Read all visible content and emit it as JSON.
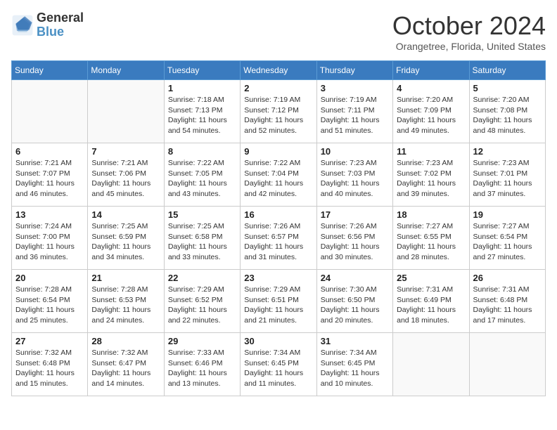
{
  "header": {
    "logo_line1": "General",
    "logo_line2": "Blue",
    "month": "October 2024",
    "location": "Orangetree, Florida, United States"
  },
  "weekdays": [
    "Sunday",
    "Monday",
    "Tuesday",
    "Wednesday",
    "Thursday",
    "Friday",
    "Saturday"
  ],
  "weeks": [
    [
      {
        "day": "",
        "info": ""
      },
      {
        "day": "",
        "info": ""
      },
      {
        "day": "1",
        "info": "Sunrise: 7:18 AM\nSunset: 7:13 PM\nDaylight: 11 hours and 54 minutes."
      },
      {
        "day": "2",
        "info": "Sunrise: 7:19 AM\nSunset: 7:12 PM\nDaylight: 11 hours and 52 minutes."
      },
      {
        "day": "3",
        "info": "Sunrise: 7:19 AM\nSunset: 7:11 PM\nDaylight: 11 hours and 51 minutes."
      },
      {
        "day": "4",
        "info": "Sunrise: 7:20 AM\nSunset: 7:09 PM\nDaylight: 11 hours and 49 minutes."
      },
      {
        "day": "5",
        "info": "Sunrise: 7:20 AM\nSunset: 7:08 PM\nDaylight: 11 hours and 48 minutes."
      }
    ],
    [
      {
        "day": "6",
        "info": "Sunrise: 7:21 AM\nSunset: 7:07 PM\nDaylight: 11 hours and 46 minutes."
      },
      {
        "day": "7",
        "info": "Sunrise: 7:21 AM\nSunset: 7:06 PM\nDaylight: 11 hours and 45 minutes."
      },
      {
        "day": "8",
        "info": "Sunrise: 7:22 AM\nSunset: 7:05 PM\nDaylight: 11 hours and 43 minutes."
      },
      {
        "day": "9",
        "info": "Sunrise: 7:22 AM\nSunset: 7:04 PM\nDaylight: 11 hours and 42 minutes."
      },
      {
        "day": "10",
        "info": "Sunrise: 7:23 AM\nSunset: 7:03 PM\nDaylight: 11 hours and 40 minutes."
      },
      {
        "day": "11",
        "info": "Sunrise: 7:23 AM\nSunset: 7:02 PM\nDaylight: 11 hours and 39 minutes."
      },
      {
        "day": "12",
        "info": "Sunrise: 7:23 AM\nSunset: 7:01 PM\nDaylight: 11 hours and 37 minutes."
      }
    ],
    [
      {
        "day": "13",
        "info": "Sunrise: 7:24 AM\nSunset: 7:00 PM\nDaylight: 11 hours and 36 minutes."
      },
      {
        "day": "14",
        "info": "Sunrise: 7:25 AM\nSunset: 6:59 PM\nDaylight: 11 hours and 34 minutes."
      },
      {
        "day": "15",
        "info": "Sunrise: 7:25 AM\nSunset: 6:58 PM\nDaylight: 11 hours and 33 minutes."
      },
      {
        "day": "16",
        "info": "Sunrise: 7:26 AM\nSunset: 6:57 PM\nDaylight: 11 hours and 31 minutes."
      },
      {
        "day": "17",
        "info": "Sunrise: 7:26 AM\nSunset: 6:56 PM\nDaylight: 11 hours and 30 minutes."
      },
      {
        "day": "18",
        "info": "Sunrise: 7:27 AM\nSunset: 6:55 PM\nDaylight: 11 hours and 28 minutes."
      },
      {
        "day": "19",
        "info": "Sunrise: 7:27 AM\nSunset: 6:54 PM\nDaylight: 11 hours and 27 minutes."
      }
    ],
    [
      {
        "day": "20",
        "info": "Sunrise: 7:28 AM\nSunset: 6:54 PM\nDaylight: 11 hours and 25 minutes."
      },
      {
        "day": "21",
        "info": "Sunrise: 7:28 AM\nSunset: 6:53 PM\nDaylight: 11 hours and 24 minutes."
      },
      {
        "day": "22",
        "info": "Sunrise: 7:29 AM\nSunset: 6:52 PM\nDaylight: 11 hours and 22 minutes."
      },
      {
        "day": "23",
        "info": "Sunrise: 7:29 AM\nSunset: 6:51 PM\nDaylight: 11 hours and 21 minutes."
      },
      {
        "day": "24",
        "info": "Sunrise: 7:30 AM\nSunset: 6:50 PM\nDaylight: 11 hours and 20 minutes."
      },
      {
        "day": "25",
        "info": "Sunrise: 7:31 AM\nSunset: 6:49 PM\nDaylight: 11 hours and 18 minutes."
      },
      {
        "day": "26",
        "info": "Sunrise: 7:31 AM\nSunset: 6:48 PM\nDaylight: 11 hours and 17 minutes."
      }
    ],
    [
      {
        "day": "27",
        "info": "Sunrise: 7:32 AM\nSunset: 6:48 PM\nDaylight: 11 hours and 15 minutes."
      },
      {
        "day": "28",
        "info": "Sunrise: 7:32 AM\nSunset: 6:47 PM\nDaylight: 11 hours and 14 minutes."
      },
      {
        "day": "29",
        "info": "Sunrise: 7:33 AM\nSunset: 6:46 PM\nDaylight: 11 hours and 13 minutes."
      },
      {
        "day": "30",
        "info": "Sunrise: 7:34 AM\nSunset: 6:45 PM\nDaylight: 11 hours and 11 minutes."
      },
      {
        "day": "31",
        "info": "Sunrise: 7:34 AM\nSunset: 6:45 PM\nDaylight: 11 hours and 10 minutes."
      },
      {
        "day": "",
        "info": ""
      },
      {
        "day": "",
        "info": ""
      }
    ]
  ]
}
